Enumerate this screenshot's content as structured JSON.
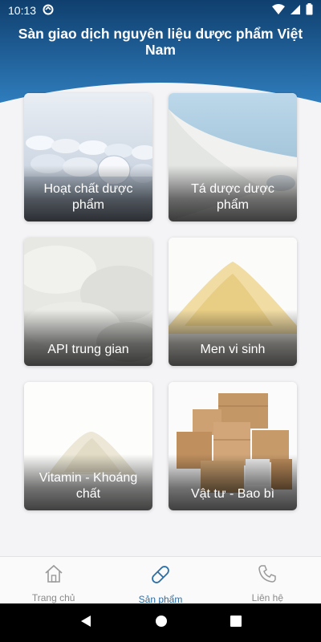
{
  "status_bar": {
    "time": "10:13"
  },
  "header": {
    "title": "Sàn giao dịch nguyên liệu dược phẩm Việt Nam"
  },
  "colors": {
    "header_top": "#0f3f6e",
    "header_bottom": "#2a73b2",
    "accent": "#2b6fa8",
    "inactive": "#8a8a8a"
  },
  "categories": [
    {
      "label": "Hoạt chất dược phẩm",
      "icon": "tablets-image"
    },
    {
      "label": "Tá dược dược phẩm",
      "icon": "powder-pile-image"
    },
    {
      "label": "API trung gian",
      "icon": "white-powder-image"
    },
    {
      "label": "Men vi sinh",
      "icon": "yellow-powder-image"
    },
    {
      "label": "Vitamin - Khoáng chất",
      "icon": "powder-mound-image"
    },
    {
      "label": "Vật tư - Bao bì",
      "icon": "cardboard-boxes-image"
    }
  ],
  "bottom_nav": {
    "items": [
      {
        "label": "Trang chủ",
        "icon": "home-icon",
        "active": false
      },
      {
        "label": "Sản phẩm",
        "icon": "capsule-icon",
        "active": true
      },
      {
        "label": "Liên hệ",
        "icon": "phone-icon",
        "active": false
      }
    ]
  }
}
